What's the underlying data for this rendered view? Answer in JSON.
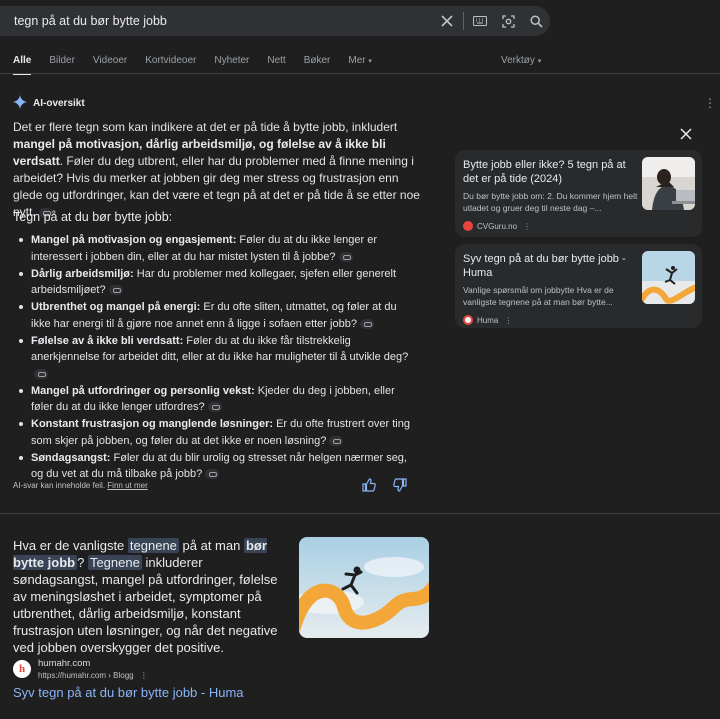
{
  "search": {
    "query": "tegn på at du bør bytte jobb",
    "icons": [
      "clear-icon",
      "keyboard-icon",
      "lens-icon",
      "search-icon"
    ]
  },
  "tabs": [
    "Alle",
    "Bilder",
    "Videoer",
    "Kortvideoer",
    "Nyheter",
    "Nett",
    "Bøker",
    "Mer"
  ],
  "active_tab": "Alle",
  "tools_label": "Verktøy",
  "ai_overview": {
    "label": "AI-oversikt",
    "intro_1": "Det er flere tegn som kan indikere at det er på tide å bytte jobb, inkludert ",
    "intro_bold": "mangel på motivasjon, dårlig arbeidsmiljø, og følelse av å ikke bli verdsatt",
    "intro_2": ". Føler du deg utbrent, eller har du problemer med å finne mening i arbeidet? Hvis du merker at jobben gir deg mer stress og frustrasjon enn glede og utfordringer, kan det være et tegn på at det er på tide å se etter noe nytt.",
    "subheading": "Tegn på at du bør bytte jobb:",
    "items": [
      {
        "bold": "Mangel på motivasjon og engasjement:",
        "text": " Føler du at du ikke lenger er interessert i jobben din, eller at du har mistet lysten til å jobbe?"
      },
      {
        "bold": "Dårlig arbeidsmiljø:",
        "text": " Har du problemer med kollegaer, sjefen eller generelt arbeidsmiljøet?"
      },
      {
        "bold": "Utbrenthet og mangel på energi:",
        "text": " Er du ofte sliten, utmattet, og føler at du ikke har energi til å gjøre noe annet enn å ligge i sofaen etter jobb?"
      },
      {
        "bold": "Følelse av å ikke bli verdsatt:",
        "text": " Føler du at du ikke får tilstrekkelig anerkjennelse for arbeidet ditt, eller at du ikke har muligheter til å utvikle deg?"
      },
      {
        "bold": "Mangel på utfordringer og personlig vekst:",
        "text": " Kjeder du deg i jobben, eller føler du at du ikke lenger utfordres?"
      },
      {
        "bold": "Konstant frustrasjon og manglende løsninger:",
        "text": " Er du ofte frustrert over ting som skjer på jobben, og føler du at det ikke er noen løsning?"
      },
      {
        "bold": "Søndagsangst:",
        "text": " Føler du at du blir urolig og stresset når helgen nærmer seg, og du vet at du må tilbake på jobb?"
      }
    ],
    "footer_text": "AI-svar kan inneholde feil.",
    "footer_link": "Finn ut mer"
  },
  "sources": [
    {
      "title": "Bytte jobb eller ikke? 5 tegn på at det er på tide (2024)",
      "snippet": "Du bør bytte jobb om: 2. Du kommer hjem helt utladet og gruer deg til neste dag –...",
      "site": "CVGuru.no",
      "accent": "#e8453c"
    },
    {
      "title": "Syv tegn på at du bør bytte jobb - Huma",
      "snippet": "Vanlige spørsmål om jobbytte Hva er de vanligste tegnene på at man bør bytte...",
      "site": "Huma",
      "accent": "#e8453c"
    }
  ],
  "featured": {
    "p1": "Hva er de vanligste ",
    "h1": "tegnene",
    "p2": " på at man ",
    "h2": "bør bytte jobb",
    "p3": "? ",
    "h3": "Tegnene",
    "p4": " inkluderer søndagsangst, mangel på utfordringer, følelse av meningsløshet i arbeidet, symptomer på utbrenthet, dårlig arbeidsmiljø, konstant frustrasjon uten løsninger, og når det negative ved jobben overskygger det positive.",
    "site_name": "humahr.com",
    "site_url": "https://humahr.com › Blogg",
    "result_title": "Syv tegn på at du bør bytte jobb - Huma"
  },
  "colors": {
    "background": "#1f1f1f",
    "link": "#8ab4f8",
    "highlight": "#394457",
    "card": "#282a2c"
  }
}
